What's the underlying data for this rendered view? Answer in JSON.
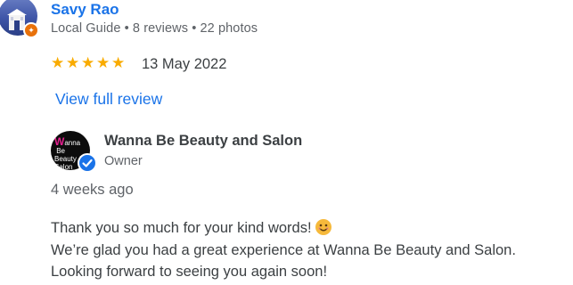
{
  "reviewer": {
    "name": "Savy Rao",
    "meta": "Local Guide • 8 reviews • 22 photos"
  },
  "review": {
    "stars": 5,
    "date": "13 May 2022",
    "view_full_label": "View full review"
  },
  "owner": {
    "name": "Wanna Be Beauty and Salon",
    "role": "Owner",
    "reply_time": "4 weeks ago",
    "reply_lines": [
      "Thank you so much for your kind words!",
      "We’re glad you had a great experience at Wanna Be Beauty and Salon.",
      "Looking forward to seeing you again soon!"
    ]
  },
  "colors": {
    "link": "#1a73e8",
    "star": "#f9ab00",
    "badge": "#e8710a"
  },
  "icons": {
    "badge": "local-guide-badge-icon",
    "verified": "verified-check-icon",
    "emoji": "smiling-face-icon"
  }
}
